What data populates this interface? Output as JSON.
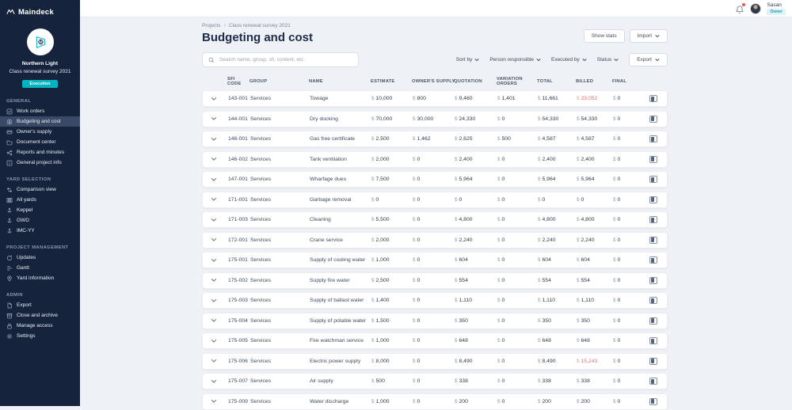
{
  "app": {
    "logo_text": "Maindeck"
  },
  "topbar": {
    "user_name": "Sasan",
    "user_role": "Owner"
  },
  "sidebar": {
    "project": {
      "line1": "Northern Light",
      "line2": "Class renewal survey 2021",
      "phase_badge": "Execution"
    },
    "sections": [
      {
        "label": "GENERAL",
        "items": [
          {
            "label": "Work orders",
            "icon": "work-orders-icon"
          },
          {
            "label": "Budgeting and cost",
            "icon": "budgeting-icon",
            "active": true
          },
          {
            "label": "Owner's supply",
            "icon": "owners-supply-icon"
          },
          {
            "label": "Document center",
            "icon": "document-center-icon"
          },
          {
            "label": "Reports and minutes",
            "icon": "reports-icon"
          },
          {
            "label": "General project info",
            "icon": "info-icon"
          }
        ]
      },
      {
        "label": "YARD SELECTION",
        "items": [
          {
            "label": "Comparison view",
            "icon": "comparison-icon"
          },
          {
            "label": "All yards",
            "icon": "all-yards-icon"
          },
          {
            "label": "Keppel",
            "icon": "yard-icon"
          },
          {
            "label": "GWD",
            "icon": "yard-icon"
          },
          {
            "label": "IMC-YY",
            "icon": "yard-icon"
          }
        ]
      },
      {
        "label": "PROJECT MANAGEMENT",
        "items": [
          {
            "label": "Updates",
            "icon": "updates-icon"
          },
          {
            "label": "Gantt",
            "icon": "gantt-icon"
          },
          {
            "label": "Yard information",
            "icon": "pin-icon"
          }
        ]
      },
      {
        "label": "ADMIN",
        "items": [
          {
            "label": "Export",
            "icon": "export-icon"
          },
          {
            "label": "Close and archive",
            "icon": "archive-icon"
          },
          {
            "label": "Manage access",
            "icon": "lock-icon"
          },
          {
            "label": "Settings",
            "icon": "gear-icon"
          }
        ]
      }
    ]
  },
  "header": {
    "breadcrumb": [
      "Projects",
      "Class renewal survey 2021"
    ],
    "title": "Budgeting and cost",
    "show_stats_label": "Show stats",
    "import_label": "Import"
  },
  "filters": {
    "search_placeholder": "Search name, group, sfi, content, etc.",
    "sort_by": "Sort by",
    "person_responsible": "Person responsible",
    "executed_by": "Executed by",
    "status": "Status",
    "export_label": "Export"
  },
  "colors": {
    "sidebar_navy": "#16233D",
    "accent_teal": "#00B3BE",
    "alert_red": "#EC6A6A"
  },
  "table": {
    "currency": "$",
    "columns": [
      "SFI CODE",
      "GROUP",
      "NAME",
      "ESTIMATE",
      "OWNER'S SUPPLY",
      "QUOTATION",
      "VARIATION ORDERS",
      "TOTAL",
      "BILLED",
      "FINAL"
    ],
    "rows": [
      {
        "sfi": "143-001",
        "group": "Services",
        "name": "Towage",
        "estimate": "10,000",
        "owners_supply": "800",
        "quotation": "9,460",
        "variation_orders": "1,401",
        "total": "11,661",
        "billed": "23,052",
        "billed_alert": true,
        "final": "0"
      },
      {
        "sfi": "144-001",
        "group": "Services",
        "name": "Dry docking",
        "estimate": "70,000",
        "owners_supply": "30,000",
        "quotation": "24,330",
        "variation_orders": "0",
        "total": "54,330",
        "billed": "54,330",
        "billed_alert": false,
        "final": "0"
      },
      {
        "sfi": "146-001",
        "group": "Services",
        "name": "Gas free certificate",
        "estimate": "2,500",
        "owners_supply": "1,462",
        "quotation": "2,625",
        "variation_orders": "500",
        "total": "4,587",
        "billed": "4,587",
        "billed_alert": false,
        "final": "0"
      },
      {
        "sfi": "146-002",
        "group": "Services",
        "name": "Tank ventilation",
        "estimate": "2,000",
        "owners_supply": "0",
        "quotation": "2,400",
        "variation_orders": "0",
        "total": "2,400",
        "billed": "2,400",
        "billed_alert": false,
        "final": "0"
      },
      {
        "sfi": "147-001",
        "group": "Services",
        "name": "Wharfage dues",
        "estimate": "7,500",
        "owners_supply": "0",
        "quotation": "5,964",
        "variation_orders": "0",
        "total": "5,964",
        "billed": "5,964",
        "billed_alert": false,
        "final": "0"
      },
      {
        "sfi": "171-001",
        "group": "Services",
        "name": "Garbage removal",
        "estimate": "0",
        "owners_supply": "0",
        "quotation": "0",
        "variation_orders": "0",
        "total": "0",
        "billed": "0",
        "billed_alert": false,
        "final": "0"
      },
      {
        "sfi": "171-003",
        "group": "Services",
        "name": "Cleaning",
        "estimate": "5,500",
        "owners_supply": "0",
        "quotation": "4,800",
        "variation_orders": "0",
        "total": "4,800",
        "billed": "4,800",
        "billed_alert": false,
        "final": "0"
      },
      {
        "sfi": "172-001",
        "group": "Services",
        "name": "Crane service",
        "estimate": "2,000",
        "owners_supply": "0",
        "quotation": "2,240",
        "variation_orders": "0",
        "total": "2,240",
        "billed": "2,240",
        "billed_alert": false,
        "final": "0"
      },
      {
        "sfi": "175-001",
        "group": "Services",
        "name": "Supply of cooling water",
        "estimate": "1,000",
        "owners_supply": "0",
        "quotation": "604",
        "variation_orders": "0",
        "total": "604",
        "billed": "604",
        "billed_alert": false,
        "final": "0"
      },
      {
        "sfi": "175-002",
        "group": "Services",
        "name": "Supply fire water",
        "estimate": "2,500",
        "owners_supply": "0",
        "quotation": "554",
        "variation_orders": "0",
        "total": "554",
        "billed": "554",
        "billed_alert": false,
        "final": "0"
      },
      {
        "sfi": "175-003",
        "group": "Services",
        "name": "Supply of ballast water",
        "estimate": "1,400",
        "owners_supply": "0",
        "quotation": "1,110",
        "variation_orders": "0",
        "total": "1,110",
        "billed": "1,110",
        "billed_alert": false,
        "final": "0"
      },
      {
        "sfi": "175-004",
        "group": "Services",
        "name": "Supply of potable water",
        "estimate": "1,500",
        "owners_supply": "0",
        "quotation": "350",
        "variation_orders": "0",
        "total": "350",
        "billed": "350",
        "billed_alert": false,
        "final": "0"
      },
      {
        "sfi": "175-005",
        "group": "Services",
        "name": "Fire watchman service",
        "estimate": "1,000",
        "owners_supply": "0",
        "quotation": "648",
        "variation_orders": "0",
        "total": "648",
        "billed": "648",
        "billed_alert": false,
        "final": "0"
      },
      {
        "sfi": "175-006",
        "group": "Services",
        "name": "Electric power supply",
        "estimate": "8,000",
        "owners_supply": "0",
        "quotation": "8,490",
        "variation_orders": "0",
        "total": "8,490",
        "billed": "15,243",
        "billed_alert": true,
        "final": "0"
      },
      {
        "sfi": "175-007",
        "group": "Services",
        "name": "Air supply",
        "estimate": "500",
        "owners_supply": "0",
        "quotation": "338",
        "variation_orders": "0",
        "total": "338",
        "billed": "338",
        "billed_alert": false,
        "final": "0"
      },
      {
        "sfi": "175-009",
        "group": "Services",
        "name": "Water discharge",
        "estimate": "1,000",
        "owners_supply": "0",
        "quotation": "200",
        "variation_orders": "0",
        "total": "200",
        "billed": "200",
        "billed_alert": false,
        "final": "0"
      }
    ]
  }
}
